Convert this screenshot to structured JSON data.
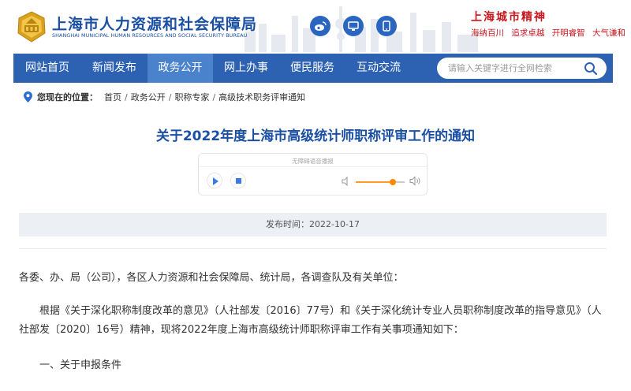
{
  "header": {
    "org_name": "上海市人力资源和社会保障局",
    "org_name_en": "SHANGHAI MUNICIPAL HUMAN RESOURCES AND SOCIAL SECURITY BUREAU",
    "spirit_title": "上海城市精神",
    "spirit_items": [
      "海纳百川",
      "追求卓越",
      "开明睿智",
      "大气谦和"
    ],
    "social_icons": [
      "weibo-icon",
      "desktop-icon",
      "mobile-icon"
    ]
  },
  "nav": {
    "items": [
      {
        "label": "网站首页",
        "active": false
      },
      {
        "label": "新闻发布",
        "active": false
      },
      {
        "label": "政务公开",
        "active": true
      },
      {
        "label": "网上办事",
        "active": false
      },
      {
        "label": "便民服务",
        "active": false
      },
      {
        "label": "互动交流",
        "active": false
      }
    ]
  },
  "search": {
    "placeholder": "请输入关键字进行全网检索"
  },
  "breadcrumb": {
    "label": "您现在的位置：",
    "items": [
      "首页",
      "政务公开",
      "职称专家",
      "高级技术职务评审通知"
    ]
  },
  "article": {
    "title": "关于2022年度上海市高级统计师职称评审工作的通知",
    "player_hint": "无障碍语音播报",
    "volume_level": 0.75,
    "publish_label": "发布时间：",
    "publish_date": "2022-10-17",
    "paragraphs": [
      "各委、办、局（公司），各区人力资源和社会保障局、统计局，各调查队及有关单位：",
      "根据《关于深化职称制度改革的意见》（人社部发〔2016〕77号）和《关于深化统计专业人员职称制度改革的指导意见》（人社部发〔2020〕16号）精神，现将2022年度上海市高级统计师职称评审工作有关事项通知如下：",
      "一、关于申报条件"
    ]
  },
  "colors": {
    "brand_blue": "#1a4fa3",
    "nav_blue": "#2d62b3",
    "nav_active": "#4b82cc",
    "accent_red": "#c8161d",
    "volume_orange": "#ff9c27"
  }
}
